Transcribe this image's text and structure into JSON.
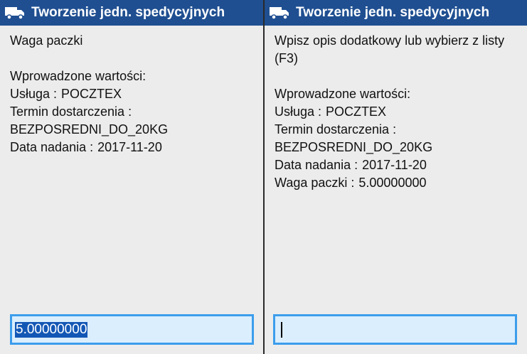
{
  "left_panel": {
    "title": "Tworzenie jedn. spedycyjnych",
    "prompt": "Waga paczki",
    "entered_heading": "Wprowadzone wartości:",
    "service_label": "Usługa :",
    "service_value": "POCZTEX",
    "delivery_term_label": "Termin dostarczenia :",
    "delivery_term_value": "BEZPOSREDNI_DO_20KG",
    "ship_date_label": "Data nadania :",
    "ship_date_value": "2017-11-20",
    "input_value": "5.00000000"
  },
  "right_panel": {
    "title": "Tworzenie jedn. spedycyjnych",
    "prompt": "Wpisz opis dodatkowy lub wybierz z listy (F3)",
    "entered_heading": "Wprowadzone wartości:",
    "service_label": "Usługa :",
    "service_value": "POCZTEX",
    "delivery_term_label": "Termin dostarczenia :",
    "delivery_term_value": "BEZPOSREDNI_DO_20KG",
    "ship_date_label": "Data nadania :",
    "ship_date_value": "2017-11-20",
    "weight_label": "Waga paczki :",
    "weight_value": "5.00000000",
    "input_value": ""
  },
  "icons": {
    "title_icon": "truck-icon"
  },
  "colors": {
    "titlebar": "#1f4f91",
    "panel_bg": "#ececec",
    "input_border": "#3c9dec",
    "input_bg": "#dbeefd",
    "selection": "#1357b5"
  }
}
